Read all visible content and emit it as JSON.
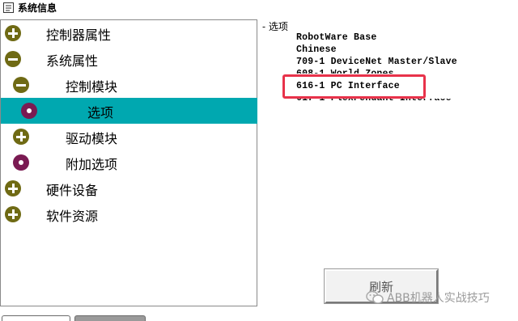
{
  "window": {
    "title": "系统信息"
  },
  "tree": {
    "items": [
      {
        "label": "控制器属性",
        "icon": "plus-icon"
      },
      {
        "label": "系统属性",
        "icon": "minus-icon"
      },
      {
        "label": "控制模块",
        "icon": "minus-icon"
      },
      {
        "label": "选项",
        "icon": "dot-icon",
        "selected": true
      },
      {
        "label": "驱动模块",
        "icon": "plus-icon"
      },
      {
        "label": "附加选项",
        "icon": "dot-icon"
      },
      {
        "label": "硬件设备",
        "icon": "plus-icon"
      },
      {
        "label": "软件资源",
        "icon": "plus-icon"
      }
    ]
  },
  "details": {
    "header": "- 选项",
    "options": [
      "RobotWare Base",
      "Chinese",
      "709-1 DeviceNet Master/Slave",
      "608-1 World Zones",
      "616-1 PC Interface",
      "617-1 FlexPendant Interface"
    ],
    "highlighted_option": "616-1 PC Interface"
  },
  "buttons": {
    "refresh": "刷新"
  },
  "watermark": {
    "text": "ABB机器人实战技巧"
  },
  "colors": {
    "selected_row": "#00a8b0",
    "plus_icon": "#6f6a14",
    "dot_icon": "#7a1a52",
    "highlight_box": "#e8324a"
  }
}
